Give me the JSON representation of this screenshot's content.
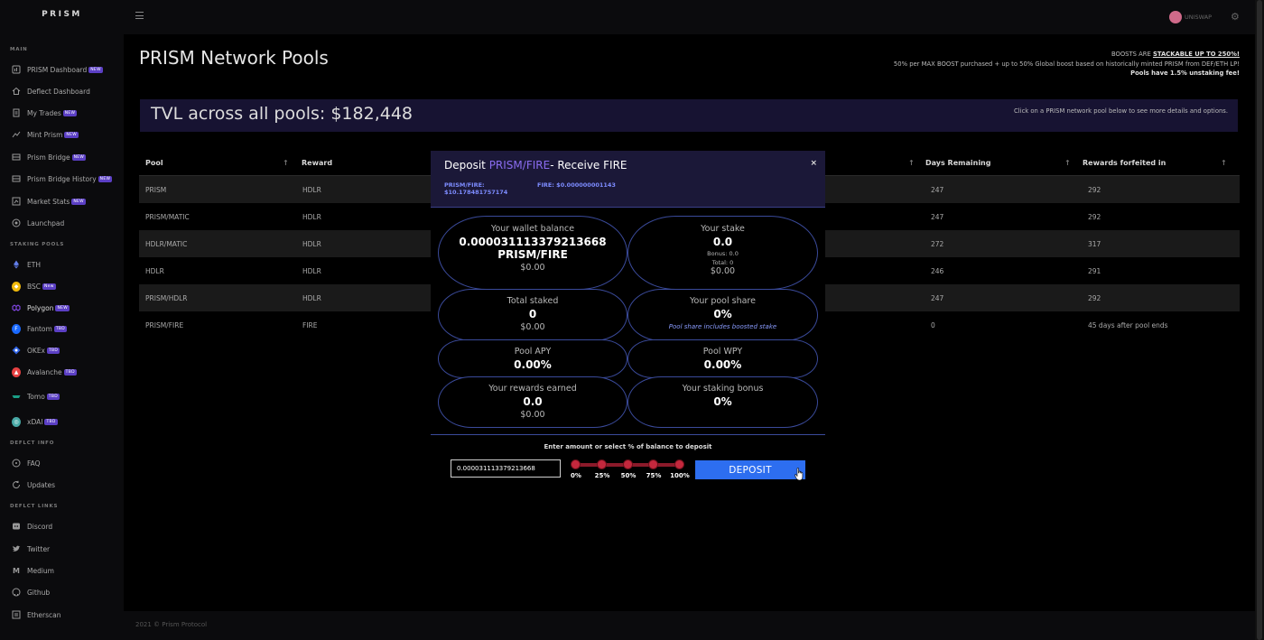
{
  "brand": "PRISM",
  "topbar": {
    "wallet_label": "UNISWAP"
  },
  "sidebar": {
    "section_main": "MAIN",
    "main_items": [
      {
        "label": "PRISM Dashboard",
        "badge": "NEW",
        "icon": "dashboard-icon"
      },
      {
        "label": "Deflect Dashboard",
        "badge": "",
        "icon": "home-icon"
      },
      {
        "label": "My Trades",
        "badge": "NEW",
        "icon": "document-icon"
      },
      {
        "label": "Mint Prism",
        "badge": "NEW",
        "icon": "mint-icon"
      },
      {
        "label": "Prism Bridge",
        "badge": "NEW",
        "icon": "bridge-icon"
      },
      {
        "label": "Prism Bridge History",
        "badge": "NEW",
        "icon": "history-icon"
      },
      {
        "label": "Market Stats",
        "badge": "NEW",
        "icon": "stats-icon"
      },
      {
        "label": "Launchpad",
        "badge": "",
        "icon": "rocket-icon"
      }
    ],
    "section_staking": "STAKING POOLS",
    "staking_items": [
      {
        "label": "ETH",
        "badge": "",
        "icon": "eth-icon",
        "color": "#627eea"
      },
      {
        "label": "BSC",
        "badge": "New",
        "icon": "bsc-icon",
        "color": "#f0b90b"
      },
      {
        "label": "Polygon",
        "badge": "NEW",
        "icon": "polygon-icon",
        "color": "#8247e5"
      },
      {
        "label": "Fantom",
        "badge": "TBD",
        "icon": "fantom-icon",
        "color": "#1969ff"
      },
      {
        "label": "OKEx",
        "badge": "TBD",
        "icon": "okex-icon",
        "color": "#2d60e0"
      },
      {
        "label": "Avalanche",
        "badge": "TBD",
        "icon": "avalanche-icon",
        "color": "#e84142"
      },
      {
        "label": "Tomo",
        "badge": "TBD",
        "icon": "tomo-icon",
        "color": "#1a9e85"
      },
      {
        "label": "xDAI",
        "badge": "TBD",
        "icon": "xdai-icon",
        "color": "#48a9a6"
      }
    ],
    "section_info": "DEFLCT INFO",
    "info_items": [
      {
        "label": "FAQ",
        "icon": "help-icon"
      },
      {
        "label": "Updates",
        "icon": "refresh-icon"
      }
    ],
    "section_links": "DEFLCT LINKS",
    "link_items": [
      {
        "label": "Discord",
        "icon": "discord-icon"
      },
      {
        "label": "Twitter",
        "icon": "twitter-icon"
      },
      {
        "label": "Medium",
        "icon": "medium-icon"
      },
      {
        "label": "Github",
        "icon": "github-icon"
      },
      {
        "label": "Etherscan",
        "icon": "etherscan-icon"
      }
    ]
  },
  "main": {
    "title": "PRISM Network Pools",
    "boost_line1_pre": "BOOSTS ARE ",
    "boost_line1_strong": "STACKABLE UP TO 250%!",
    "boost_line2": "50% per MAX BOOST purchased + up to 50% Global boost based on historically minted PRISM from DEF/ETH LP!",
    "boost_line3": "Pools have 1.5% unstaking fee!",
    "tvl": "TVL across all pools: $182,448",
    "tvl_hint": "Click on a PRISM network pool below to see more details and options."
  },
  "table": {
    "headers": {
      "pool": "Pool",
      "reward": "Reward",
      "days": "Days Remaining",
      "forfeited": "Rewards forfeited in"
    },
    "rows": [
      {
        "pool": "PRISM",
        "reward": "HDLR",
        "days": "247",
        "forfeited": "292"
      },
      {
        "pool": "PRISM/MATIC",
        "reward": "HDLR",
        "days": "247",
        "forfeited": "292"
      },
      {
        "pool": "HDLR/MATIC",
        "reward": "HDLR",
        "days": "272",
        "forfeited": "317"
      },
      {
        "pool": "HDLR",
        "reward": "HDLR",
        "days": "246",
        "forfeited": "291"
      },
      {
        "pool": "PRISM/HDLR",
        "reward": "HDLR",
        "days": "247",
        "forfeited": "292"
      },
      {
        "pool": "PRISM/FIRE",
        "reward": "FIRE",
        "days": "0",
        "forfeited": "45 days after pool ends"
      }
    ]
  },
  "modal": {
    "title_pre": "Deposit ",
    "title_pair": "PRISM/FIRE",
    "title_post": "- Receive FIRE",
    "close": "×",
    "price_pair": "PRISM/FIRE: $10.178481757174",
    "price_fire": "FIRE: $0.000000001143",
    "wallet": {
      "label": "Your wallet balance",
      "value": "0.000031113379213668 PRISM/FIRE",
      "usd": "$0.00"
    },
    "stake": {
      "label": "Your stake",
      "value": "0.0",
      "bonus": "Bonus: 0.0",
      "total": "Total: 0",
      "usd": "$0.00"
    },
    "total_staked": {
      "label": "Total staked",
      "value": "0",
      "usd": "$0.00"
    },
    "pool_share": {
      "label": "Your pool share",
      "value": "0%",
      "note": "Pool share includes boosted stake"
    },
    "apy": {
      "label": "Pool APY",
      "value": "0.00%"
    },
    "wpy": {
      "label": "Pool WPY",
      "value": "0.00%"
    },
    "rewards": {
      "label": "Your rewards earned",
      "value": "0.0",
      "usd": "$0.00"
    },
    "bonus": {
      "label": "Your staking bonus",
      "value": "0%"
    },
    "enter_label": "Enter amount or select % of balance to deposit",
    "amount_value": "0.000031113379213668",
    "percents": [
      "0%",
      "25%",
      "50%",
      "75%",
      "100%"
    ],
    "deposit_label": "DEPOSIT"
  },
  "footer": "2021 © Prism Protocol"
}
